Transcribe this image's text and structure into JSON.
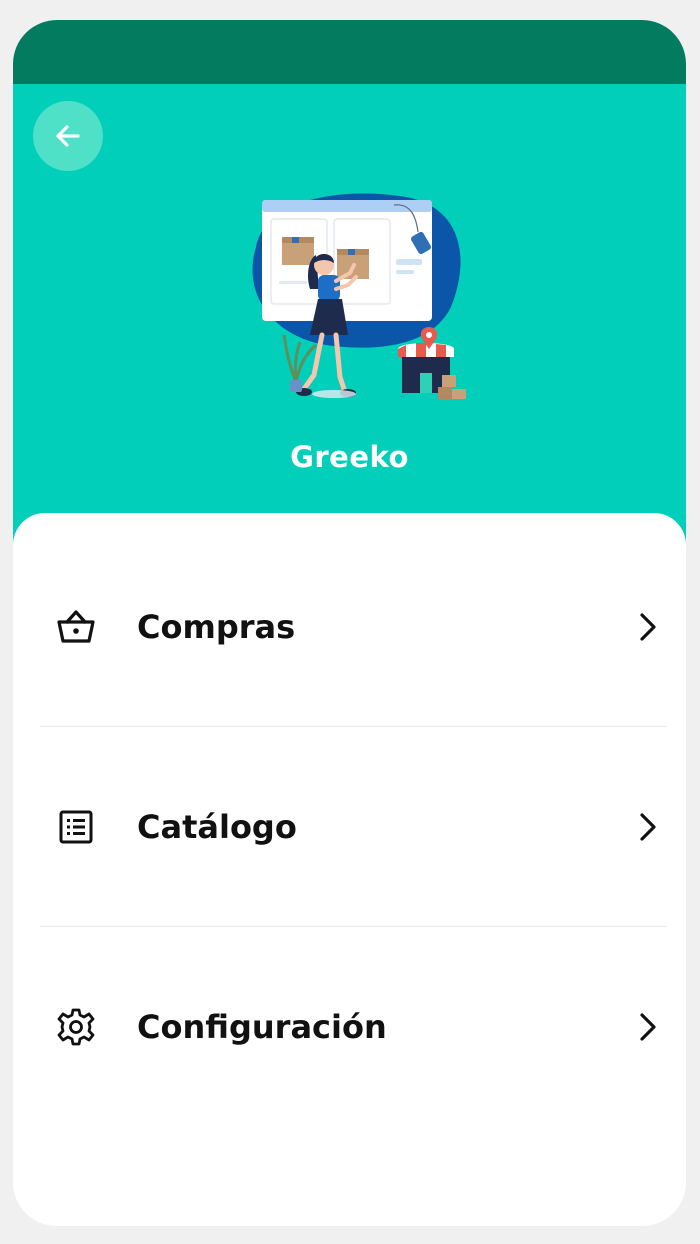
{
  "header": {
    "back_icon": "arrow-left-icon",
    "store_name": "Greeko",
    "colors": {
      "status_bar": "#027b5f",
      "hero": "#02cfb9",
      "back_button": "#4fe0c8"
    }
  },
  "menu": {
    "items": [
      {
        "label": "Compras",
        "icon": "basket-icon"
      },
      {
        "label": "Catálogo",
        "icon": "list-icon"
      },
      {
        "label": "Configuración",
        "icon": "gear-icon"
      }
    ],
    "chevron_icon": "chevron-right-icon"
  }
}
